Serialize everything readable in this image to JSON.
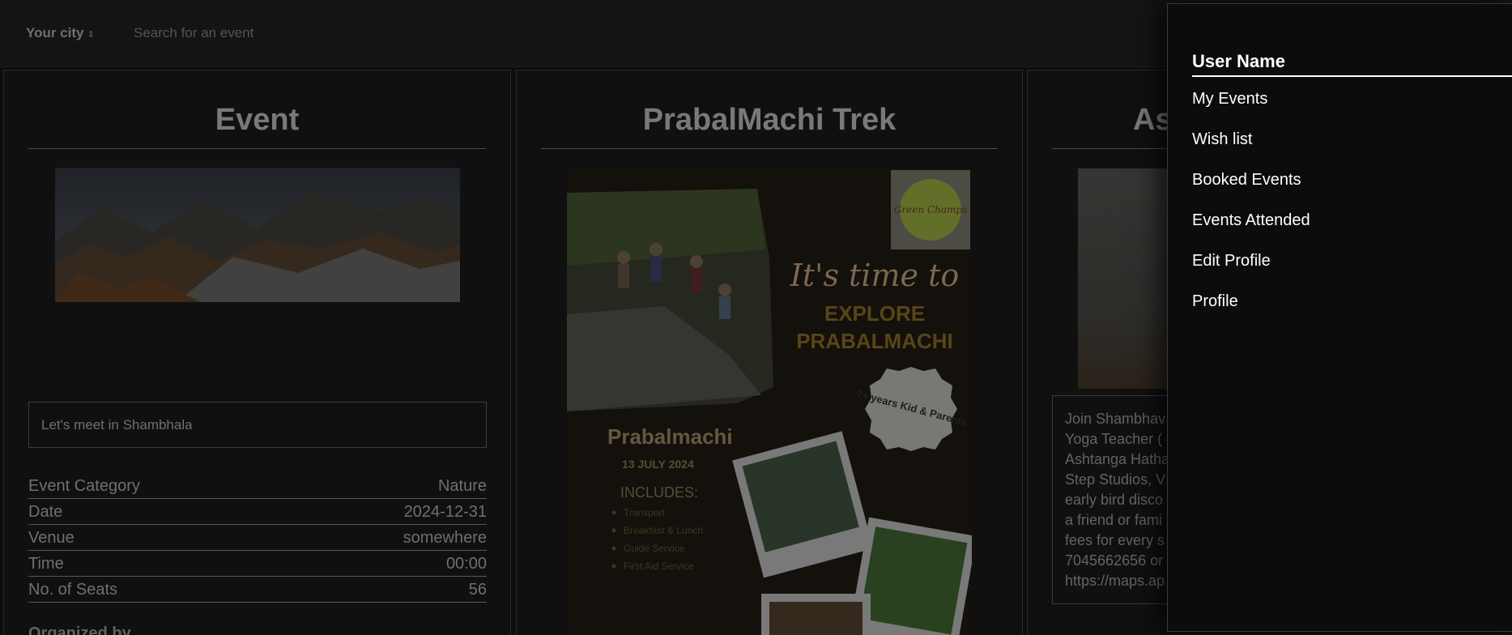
{
  "header": {
    "city_label": "Your city",
    "city_chevron": "⇕",
    "search_placeholder": "Search for an event"
  },
  "cards": [
    {
      "title": "Event",
      "description": "Let's meet in Shambhala",
      "details": [
        {
          "label": "Event Category",
          "value": "Nature"
        },
        {
          "label": "Date",
          "value": "2024-12-31"
        },
        {
          "label": "Venue",
          "value": "somewhere"
        },
        {
          "label": "Time",
          "value": "00:00"
        },
        {
          "label": "No. of Seats",
          "value": "56"
        }
      ],
      "below_text": "Organized by"
    },
    {
      "title": "PrabalMachi Trek",
      "poster": {
        "logo_text": "Green Champs",
        "headline_script": "It's time to",
        "headline_line1": "EXPLORE",
        "headline_line2": "PRABALMACHI",
        "badge": "7+ years Kid & Parents",
        "place": "Prabalmachi",
        "date": "13 JULY 2024",
        "includes_title": "INCLUDES:",
        "includes": [
          "Transport",
          "Breakfast & Lunch",
          "Guide Service",
          "First Aid Service"
        ]
      }
    },
    {
      "title": "As",
      "description_lines": [
        "Join Shambhav",
        "Yoga Teacher (",
        "Ashtanga Hatha",
        "Step Studios, V",
        "early bird disco",
        "a friend or fami",
        "fees for every s",
        "7045662656 or",
        "https://maps.ap"
      ]
    }
  ],
  "drawer": {
    "user_name": "User Name",
    "items": [
      "My Events",
      "Wish list",
      "Booked Events",
      "Events Attended",
      "Edit Profile",
      "Profile"
    ]
  },
  "colors": {
    "page_bg": "#121212",
    "drawer_bg": "#0c0c0c",
    "poster_accent": "#e0a826"
  }
}
